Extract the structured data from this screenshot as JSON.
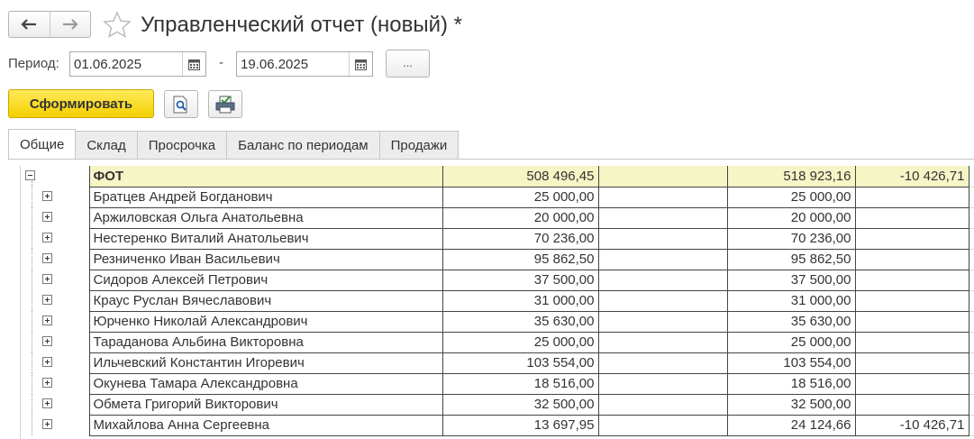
{
  "window": {
    "title": "Управленческий отчет (новый) *"
  },
  "period": {
    "label": "Период:",
    "from": "01.06.2025",
    "separator": "-",
    "to": "19.06.2025",
    "more_label": "..."
  },
  "actions": {
    "generate_label": "Сформировать"
  },
  "tabs": [
    {
      "label": "Общие",
      "active": true
    },
    {
      "label": "Склад",
      "active": false
    },
    {
      "label": "Просрочка",
      "active": false
    },
    {
      "label": "Баланс по периодам",
      "active": false
    },
    {
      "label": "Продажи",
      "active": false
    }
  ],
  "report": {
    "total": {
      "name": "ФОТ",
      "col1": "508 496,45",
      "col2": "",
      "col3": "518 923,16",
      "col4": "-10 426,71"
    },
    "rows": [
      {
        "name": "Братцев Андрей Богданович",
        "col1": "25 000,00",
        "col3": "25 000,00",
        "col4": ""
      },
      {
        "name": "Аржиловская Ольга Анатольевна",
        "col1": "20 000,00",
        "col3": "20 000,00",
        "col4": ""
      },
      {
        "name": "Нестеренко Виталий Анатольевич",
        "col1": "70 236,00",
        "col3": "70 236,00",
        "col4": ""
      },
      {
        "name": "Резниченко Иван Васильевич",
        "col1": "95 862,50",
        "col3": "95 862,50",
        "col4": ""
      },
      {
        "name": "Сидоров Алексей Петрович",
        "col1": "37 500,00",
        "col3": "37 500,00",
        "col4": ""
      },
      {
        "name": "Краус Руслан Вячеславович",
        "col1": "31 000,00",
        "col3": "31 000,00",
        "col4": ""
      },
      {
        "name": "Юрченко Николай Александрович",
        "col1": "35 630,00",
        "col3": "35 630,00",
        "col4": ""
      },
      {
        "name": "Тараданова Альбина Викторовна",
        "col1": "25 000,00",
        "col3": "25 000,00",
        "col4": ""
      },
      {
        "name": "Ильчевский Константин Игоревич",
        "col1": "103 554,00",
        "col3": "103 554,00",
        "col4": ""
      },
      {
        "name": "Окунева Тамара Александровна",
        "col1": "18 516,00",
        "col3": "18 516,00",
        "col4": ""
      },
      {
        "name": "Обмета Григорий Викторович",
        "col1": "32 500,00",
        "col3": "32 500,00",
        "col4": ""
      },
      {
        "name": "Михайлова Анна Сергеевна",
        "col1": "13 697,95",
        "col3": "24 124,66",
        "col4": "-10 426,71"
      }
    ]
  },
  "colors": {
    "accent_button": "#f5d000",
    "total_row_bg": "#f5f5c6"
  },
  "icons": [
    "arrow-left-icon",
    "arrow-right-icon",
    "star-icon",
    "calendar-icon",
    "preview-icon",
    "print-icon",
    "expand-icon",
    "collapse-icon"
  ]
}
